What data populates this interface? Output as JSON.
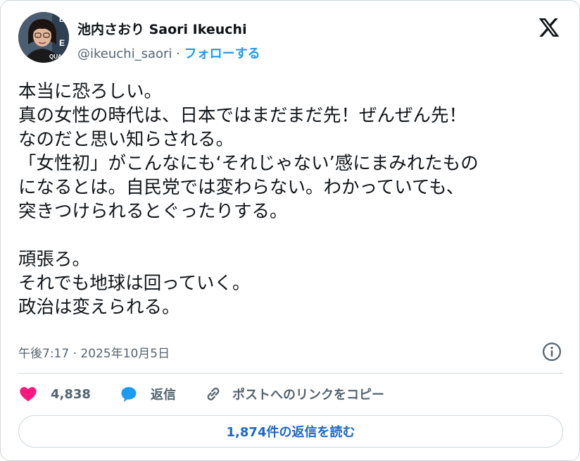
{
  "author": {
    "name": "池内さおり Saori Ikeuchi",
    "handle": "@ikeuchi_saori",
    "separator": "·",
    "follow_label": "フォローする",
    "avatar_letters": [
      "E",
      "E",
      "QUA"
    ]
  },
  "post": {
    "lines": [
      "本当に恐ろしい。",
      "真の女性の時代は、日本ではまだまだ先！ぜんぜん先！",
      "なのだと思い知らされる。",
      "「女性初」がこんなにも‘それじゃない’感にまみれたもの",
      "になるとは。自民党では変わらない。わかっていても、",
      "突きつけられるとぐったりする。",
      "",
      "頑張ろ。",
      "それでも地球は回っていく。",
      "政治は変えられる。"
    ],
    "timestamp": "午後7:17 · 2025年10月5日"
  },
  "actions": {
    "like_count": "4,838",
    "reply_label": "返信",
    "copy_link_label": "ポストへのリンクをコピー"
  },
  "read_replies_label": "1,874件の返信を読む",
  "icons": [
    "x-logo-icon",
    "info-icon",
    "heart-icon",
    "reply-icon",
    "link-icon"
  ],
  "colors": {
    "accent": "#1d9bf0",
    "heart": "#f91880",
    "muted": "#536471",
    "border": "#cfd9de"
  }
}
